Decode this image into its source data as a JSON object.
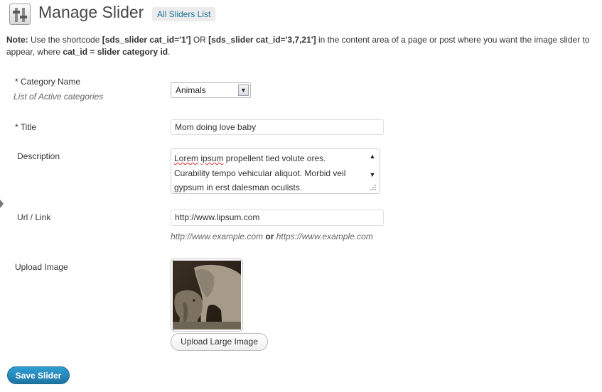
{
  "header": {
    "title": "Manage Slider",
    "all_sliders_link": "All Sliders List"
  },
  "note": {
    "prefix": "Note:",
    "t1": " Use the shortcode ",
    "code1": "[sds_slider cat_id='1']",
    "t2": " OR ",
    "code2": "[sds_slider cat_id='3,7,21']",
    "t3": " in the content area of a page or post where you want the image slider to appear, where ",
    "code3": "cat_id = slider category id",
    "t4": "."
  },
  "form": {
    "category": {
      "label": "* Category Name",
      "hint": "List of Active categories",
      "selected": "Animals"
    },
    "title": {
      "label": "* Title",
      "value": "Mom doing love baby"
    },
    "description": {
      "label": "Description",
      "word1": "Lorem",
      "word2": "ipsum",
      "rest_line1": " propellent tied volute ores.",
      "line2": "Curability tempo vehicular aliquot. Morbid veil",
      "line3": "gypsum in erst dalesman oculists."
    },
    "url": {
      "label": "Url / Link",
      "value": "http://www.lipsum.com",
      "hint_a": "http://www.example.com",
      "hint_or": "or",
      "hint_b": "https://www.example.com"
    },
    "image": {
      "label": "Upload Image",
      "alt": "elephant mother and calf",
      "upload_button": "Upload Large Image"
    }
  },
  "actions": {
    "save": "Save Slider"
  },
  "colors": {
    "link": "#21759b",
    "primary_button": "#2388b8"
  },
  "icons": {
    "page": "slider-settings-icon",
    "select_arrow": "chevron-down-icon"
  }
}
